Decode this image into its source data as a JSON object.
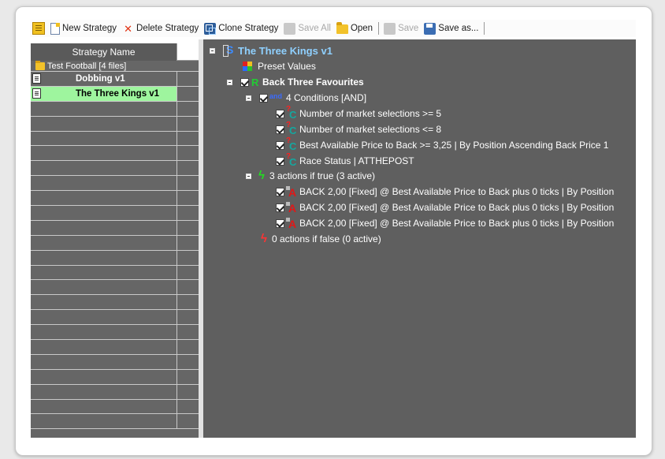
{
  "toolbar": {
    "new_strategy": "New Strategy",
    "delete_strategy": "Delete Strategy",
    "clone_strategy": "Clone Strategy",
    "save_all": "Save All",
    "open": "Open",
    "save": "Save",
    "save_as": "Save as..."
  },
  "grid": {
    "header": "Strategy Name",
    "group": "Test Football [4 files]",
    "rows": [
      {
        "name": "Dobbing v1",
        "selected": false
      },
      {
        "name": "The Three Kings v1",
        "selected": true
      }
    ]
  },
  "tree": {
    "root": "The Three Kings v1",
    "preset": "Preset Values",
    "rule": "Back Three Favourites",
    "conditions_header": "4 Conditions [AND]",
    "conditions": [
      "Number of market selections >= 5",
      "Number of market selections <= 8",
      "Best Available Price to Back >= 3,25 | By Position Ascending Back Price 1",
      "Race Status |   ATTHEPOST"
    ],
    "actions_true_header": "3 actions if true (3 active)",
    "actions_true": [
      "BACK 2,00 [Fixed] @ Best Available Price to Back plus 0 ticks | By Position",
      "BACK 2,00 [Fixed] @ Best Available Price to Back plus 0 ticks | By Position",
      "BACK 2,00 [Fixed] @ Best Available Price to Back plus 0 ticks | By Position"
    ],
    "actions_false_header": "0 actions if false (0 active)"
  },
  "colors": {
    "tree_background": "#5f5f5f",
    "grid_background": "#666666",
    "selected_row": "#9ef59e",
    "root_title": "#8fd0ff"
  }
}
